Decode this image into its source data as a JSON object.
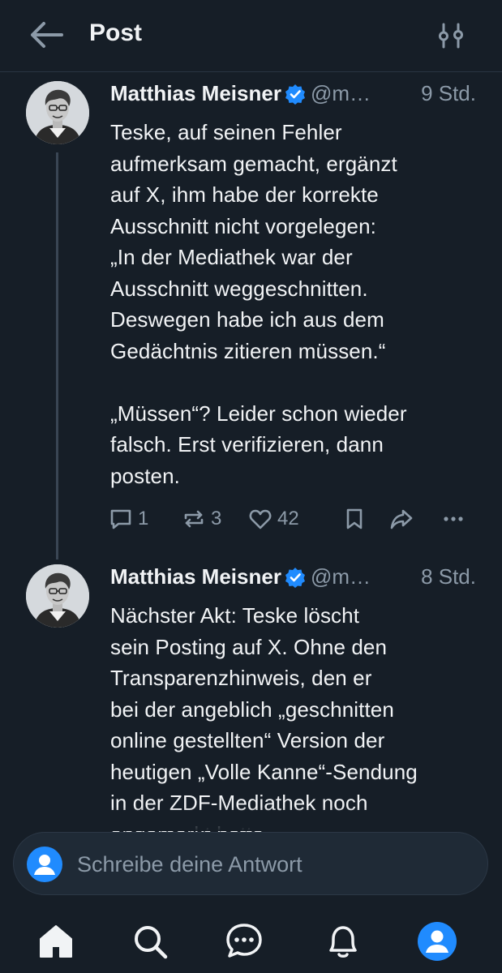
{
  "header": {
    "title": "Post"
  },
  "posts": [
    {
      "author": "Matthias Meisner",
      "handle": "@m…",
      "time": "9 Std.",
      "text": "Teske, auf seinen Fehler\naufmerksam gemacht, ergänzt\nauf X, ihm habe der korrekte\nAusschnitt nicht vorgelegen:\n„In der Mediathek war der\nAusschnitt weggeschnitten.\nDeswegen habe ich aus dem\nGedächtnis zitieren müssen.“\n\n„Müssen“? Leider schon wieder\nfalsch. Erst verifizieren, dann\nposten.",
      "replies": "1",
      "reposts": "3",
      "likes": "42"
    },
    {
      "author": "Matthias Meisner",
      "handle": "@m…",
      "time": "8 Std.",
      "text": "Nächster Akt: Teske löscht\nsein Posting auf X. Ohne den\nTransparenzhinweis, den er\nbei der angeblich „geschnitten\nonline gestellten“ Version der\nheutigen „Volle Kanne“-Sendung\nin der ZDF-Mediathek noch\nangemerkt hatte."
    }
  ],
  "reply": {
    "placeholder": "Schreibe deine Antwort"
  },
  "colors": {
    "background": "#161e27",
    "accent": "#208bfe",
    "muted": "#8c9aa8"
  },
  "icons": {
    "header": [
      "back-arrow-icon",
      "filter-sliders-icon"
    ],
    "actions": [
      "reply-icon",
      "repost-icon",
      "like-icon",
      "bookmark-icon",
      "share-icon",
      "more-icon"
    ],
    "nav": [
      "home-icon",
      "search-icon",
      "chat-icon",
      "notifications-icon",
      "profile-icon"
    ]
  }
}
